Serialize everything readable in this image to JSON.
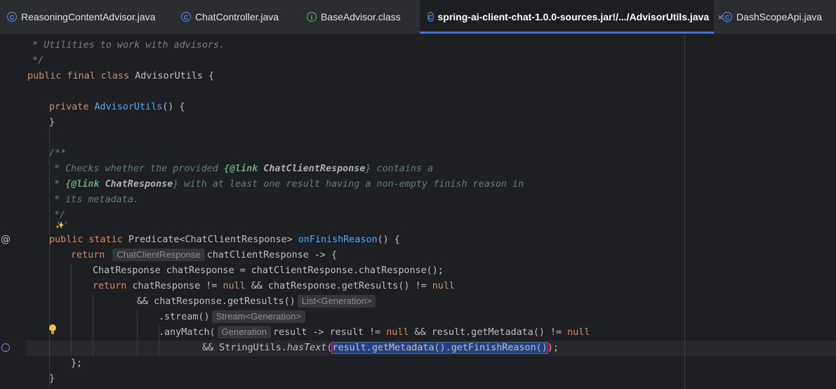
{
  "tabs": [
    {
      "icon": "C",
      "label": "ReasoningContentAdvisor.java"
    },
    {
      "icon": "C",
      "label": "ChatController.java"
    },
    {
      "icon": "I",
      "label": "BaseAdvisor.class"
    },
    {
      "icon": "C",
      "label": "spring-ai-client-chat-1.0.0-sources.jar!/.../AdvisorUtils.java",
      "close": "×"
    },
    {
      "icon": "C",
      "label": "DashScopeApi.java"
    }
  ],
  "code": {
    "l1": "* Utilities to work with advisors.",
    "l2": "*/",
    "l3a": "public final class ",
    "l3b": "AdvisorUtils {",
    "l5a": "private ",
    "l5b": "AdvisorUtils",
    "l5c": "() {",
    "l6": "}",
    "l8": "/**",
    "l9a": "* Checks whether the provided ",
    "l9b": "{@link ",
    "l9c": "ChatClientResponse",
    "l9d": "} contains a",
    "l10a": "* ",
    "l10b": "{@link ",
    "l10c": "ChatResponse",
    "l10d": "} with at least one result having a non-empty finish reason in",
    "l11": "* its metadata.",
    "l12": "*/",
    "l12b": "✨˅",
    "l13a": "public static ",
    "l13b": "Predicate<ChatClientResponse> ",
    "l13c": "onFinishReason",
    "l13d": "() {",
    "l14a": "return",
    "l14hint": "ChatClientResponse",
    "l14b": "chatClientResponse -> {",
    "l15": "ChatResponse chatResponse = chatClientResponse.chatResponse();",
    "l16a": "return ",
    "l16b": "chatResponse != ",
    "l16c": "null",
    "l16d": " && chatResponse.getResults() != ",
    "l16e": "null",
    "l17a": "&& chatResponse.getResults()",
    "l17hint": "List<Generation>",
    "l18a": ".stream()",
    "l18hint": "Stream<Generation>",
    "l19a": ".anyMatch(",
    "l19hint": "Generation",
    "l19b": "result -> result != ",
    "l19c": "null",
    "l19d": " && result.getMetadata() != ",
    "l19e": "null",
    "l20a": "&& StringUtils.",
    "l20b": "hasText",
    "l20c": "(",
    "l20d": "result.getMetadata().getFinishReason()",
    "l20e": ");",
    "l21": "};",
    "l22": "}"
  },
  "gutter": {
    "override_marker": "@"
  },
  "colors": {
    "keyword": "#cf8e6d",
    "comment": "#7a7e85",
    "function": "#56a8f5",
    "text": "#bcbec4",
    "tab_active": "#3574f0",
    "highlight": "#e0266a"
  }
}
